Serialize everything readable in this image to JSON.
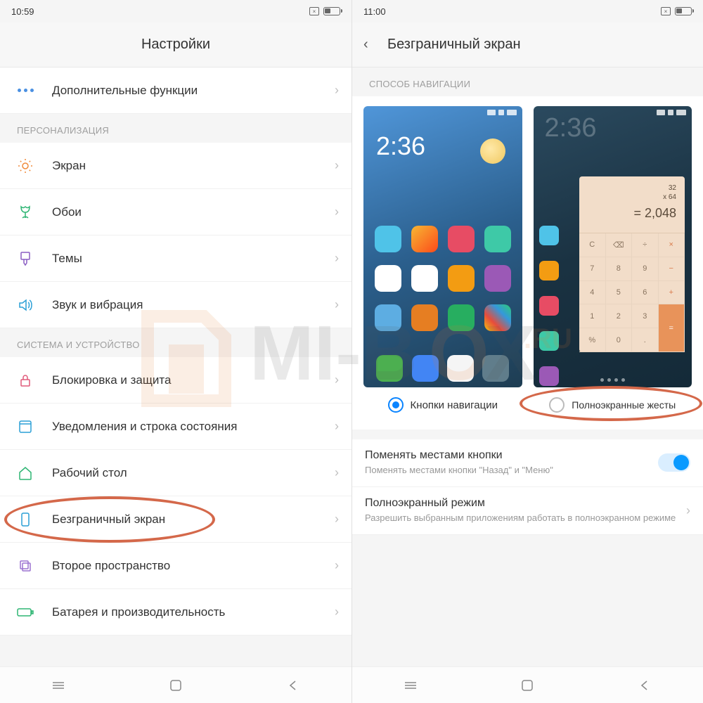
{
  "left": {
    "time": "10:59",
    "title": "Настройки",
    "rows": {
      "additional": "Дополнительные функции"
    },
    "section_personalization": "ПЕРСОНАЛИЗАЦИЯ",
    "personalization": {
      "screen": "Экран",
      "wallpaper": "Обои",
      "themes": "Темы",
      "sound": "Звук и вибрация"
    },
    "section_system": "СИСТЕМА И УСТРОЙСТВО",
    "system": {
      "lock": "Блокировка и защита",
      "notifications": "Уведомления и строка состояния",
      "desktop": "Рабочий стол",
      "fullscreen": "Безграничный экран",
      "second_space": "Второе пространство",
      "battery": "Батарея и производительность"
    }
  },
  "right": {
    "time": "11:00",
    "title": "Безграничный экран",
    "section_nav": "СПОСОБ НАВИГАЦИИ",
    "preview": {
      "clock": "2:36",
      "calc_clock": "2:36",
      "calc_line1": "32",
      "calc_line2": "x 64",
      "calc_result": "= 2,048"
    },
    "option_buttons": "Кнопки навигации",
    "option_gestures": "Полноэкранные жесты",
    "swap": {
      "title": "Поменять местами кнопки",
      "sub": "Поменять местами кнопки \"Назад\" и \"Меню\""
    },
    "fullscreen_mode": {
      "title": "Полноэкранный режим",
      "sub": "Разрешить выбранным приложениям работать в полноэкранном режиме"
    }
  },
  "watermark": "MI-BOX.RU"
}
